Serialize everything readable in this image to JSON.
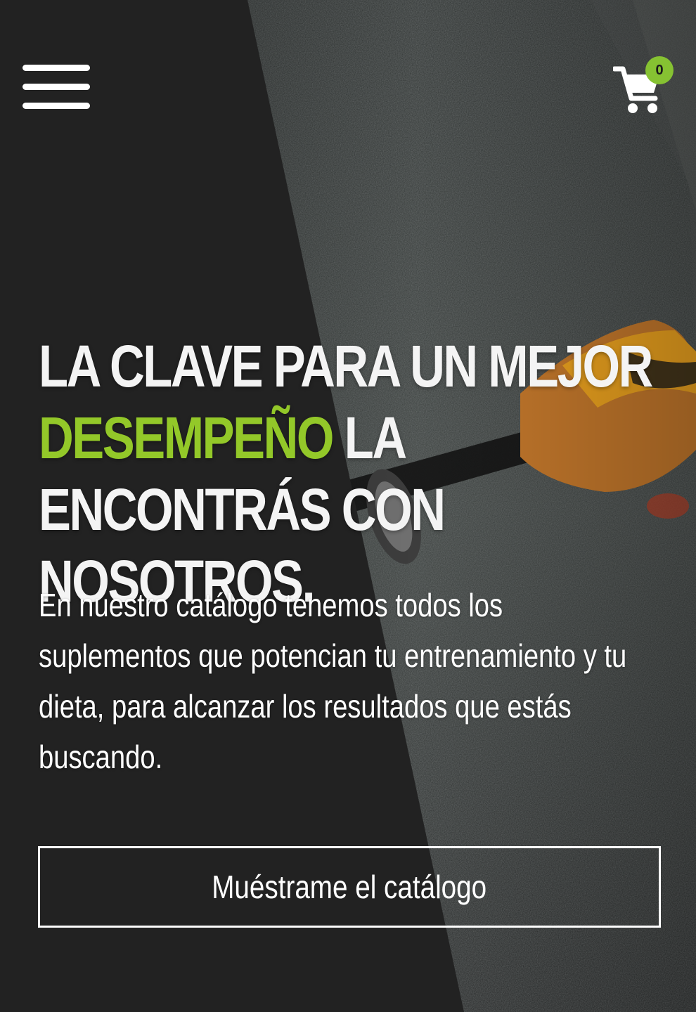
{
  "header": {
    "menu_icon": "hamburger-menu-icon",
    "cart_icon": "shopping-cart-icon",
    "cart_count": "0"
  },
  "hero": {
    "headline_part1": "LA CLAVE PARA UN MEJOR",
    "headline_accent": "DESEMPEÑO",
    "headline_part2": "LA ENCONTRÁS CON NOSOTROS.",
    "description": "En nuestro catálogo tenemos todos los suplementos que potencian tu entrenamiento y tu dieta, para alcanzar los resultados que estás buscando.",
    "cta_label": "Muéstrame el catálogo"
  },
  "colors": {
    "background": "#222222",
    "accent": "#93c829",
    "badge": "#86c232",
    "text": "#ffffff"
  }
}
